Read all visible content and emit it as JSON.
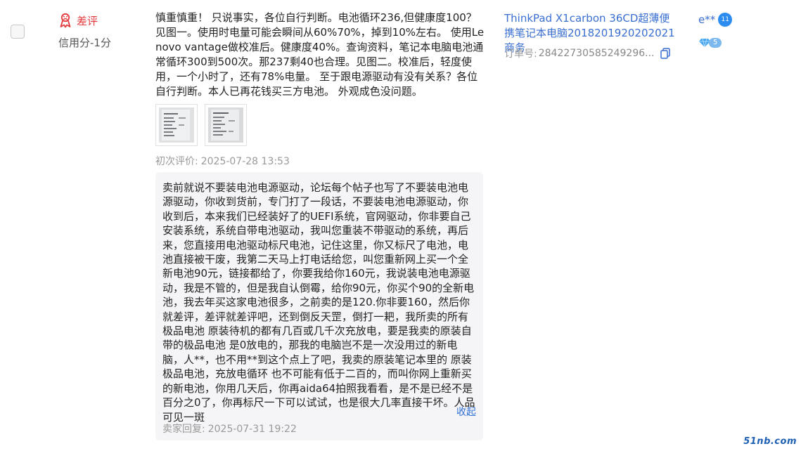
{
  "rating": {
    "label": "差评",
    "icon": "bad-review-icon",
    "color": "#e4393c"
  },
  "credit": "信用分-1分",
  "review": {
    "text": "慎重慎重！ 只说事实，各位自行判断。电池循环236,但健康度100？见图一。使用时电量可能会瞬间从60%70%，掉到10%左右。 使用Lenovo vantage做校准后。健康度40%。查询资料，笔记本电脑电池通常循环300到500次。那237剩40也合理。见图二。校准后，轻度使用，一个小时了，还有78%电量。 至于跟电源驱动有没有关系？各位自行判断。本人已再花钱买三方电池。 外观成色没问题。",
    "images": [
      "screenshot-thumbnail",
      "screenshot-thumbnail"
    ],
    "first_review_label": "初次评价:",
    "first_review_date": "2025-07-28 13:53"
  },
  "reply": {
    "text": "卖前就说不要装电池电源驱动，论坛每个帖子也写了不要装电池电源驱动，你收到货前，专门打了一段话，不要装电池电源驱动，你收到后，本来我们已经装好了的UEFI系统，官网驱动，你非要自己安装系统，系统自带电池驱动，我叫您重装不带驱动的系统，再后来，您直接用电池驱动标尺电池，记住这里，你又标尺了电池，电池直接被干废，我第二天马上打电话给您，叫您重新网上买一个全新电池90元，链接都给了，你要我给你160元，我说装电池电源驱动，我是不管的，但是我自认倒霉，给你90元，你买个90的全新电池，我去年买这家电池很多，之前卖的是120.你非要160，然后你就差评，差评就差评吧，还到倒反天罡，倒打一耙，我所卖的所有极品电池 原装待机的都有几百或几千次充放电，要是我卖的原装自带的极品电池 是0放电的，那我的电脑岂不是一次没用过的新电脑，人**，也不用**到这个点上了吧，我卖的原装笔记本里的 原装极品电池，充放电循环 也不可能有低于二百的，而叫你网上重新买的新电池，你用几天后，你再aida64拍照我看看，是不是已经不是百分之0了，你再标尺一下可以试试，也是很大几率直接干坏。人品可见一斑",
    "collapse_label": "收起",
    "time_label": "卖家回复:",
    "time": "2025-07-31 19:22"
  },
  "product": {
    "title": "ThinkPad X1carbon 36CD超薄便携笔记本电脑2018201920202021商务",
    "order_label": "订单号:",
    "order_number": "28422730585249296..."
  },
  "user": {
    "name": "e**",
    "badge": "11",
    "level": "5"
  },
  "watermark": "51nb.com",
  "colors": {
    "link": "#3a6fd1",
    "muted": "#999999",
    "reply_bg": "#f5f5f7"
  }
}
